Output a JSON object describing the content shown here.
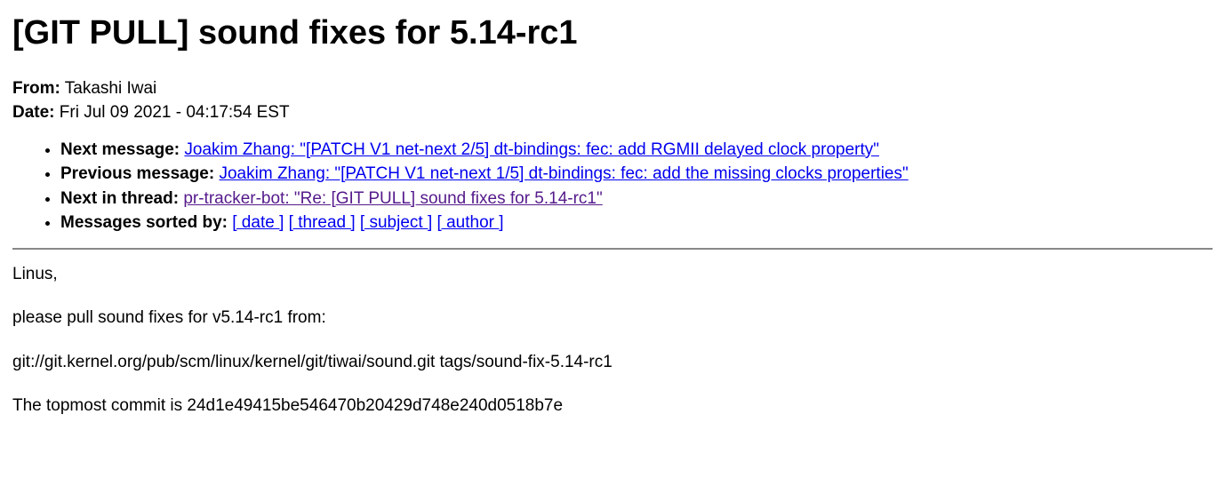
{
  "title": "[GIT PULL] sound fixes for 5.14-rc1",
  "from": {
    "label": "From:",
    "value": "Takashi Iwai"
  },
  "date": {
    "label": "Date:",
    "value": "Fri Jul 09 2021 - 04:17:54 EST"
  },
  "nav": {
    "next_message": {
      "label": "Next message:",
      "link": "Joakim Zhang: \"[PATCH V1 net-next 2/5] dt-bindings: fec: add RGMII delayed clock property\""
    },
    "previous_message": {
      "label": "Previous message:",
      "link": "Joakim Zhang: \"[PATCH V1 net-next 1/5] dt-bindings: fec: add the missing clocks properties\""
    },
    "next_in_thread": {
      "label": "Next in thread:",
      "link": "pr-tracker-bot: \"Re: [GIT PULL] sound fixes for 5.14-rc1\""
    },
    "sorted_by": {
      "label": "Messages sorted by:",
      "date": "[ date ]",
      "thread": "[ thread ]",
      "subject": "[ subject ]",
      "author": "[ author ]"
    }
  },
  "body": {
    "line1": "Linus,",
    "line2": "please pull sound fixes for v5.14-rc1 from:",
    "line3": "git://git.kernel.org/pub/scm/linux/kernel/git/tiwai/sound.git tags/sound-fix-5.14-rc1",
    "line4": "The topmost commit is 24d1e49415be546470b20429d748e240d0518b7e"
  }
}
